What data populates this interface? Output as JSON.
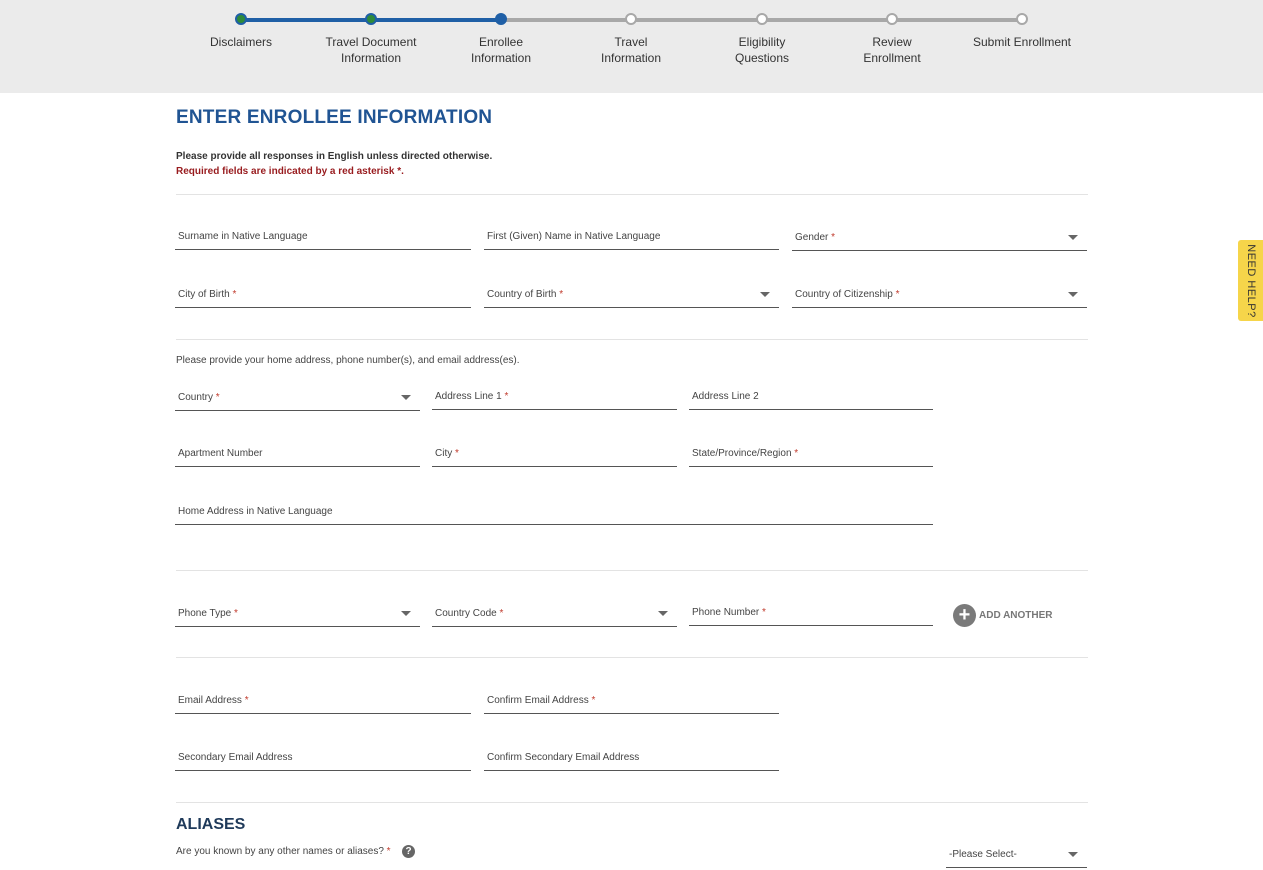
{
  "progress": {
    "steps": [
      {
        "line1": "Disclaimers",
        "line2": "",
        "state": "done"
      },
      {
        "line1": "Travel Document",
        "line2": "Information",
        "state": "done"
      },
      {
        "line1": "Enrollee",
        "line2": "Information",
        "state": "current"
      },
      {
        "line1": "Travel",
        "line2": "Information",
        "state": "pending"
      },
      {
        "line1": "Eligibility",
        "line2": "Questions",
        "state": "pending"
      },
      {
        "line1": "Review",
        "line2": "Enrollment",
        "state": "pending"
      },
      {
        "line1": "Submit Enrollment",
        "line2": "",
        "state": "pending"
      }
    ]
  },
  "page": {
    "title": "ENTER ENROLLEE INFORMATION",
    "intro": "Please provide all responses in English unless directed otherwise.",
    "required_note": "Required fields are indicated by a red asterisk *."
  },
  "personal": {
    "surname_native": {
      "label": "Surname in Native Language"
    },
    "first_name_native": {
      "label": "First (Given) Name in Native Language"
    },
    "gender": {
      "label": "Gender",
      "star": "*"
    },
    "city_of_birth": {
      "label": "City of Birth",
      "star": "*"
    },
    "country_of_birth": {
      "label": "Country of Birth",
      "star": "*"
    },
    "country_of_citizenship": {
      "label": "Country of Citizenship",
      "star": "*"
    }
  },
  "address": {
    "note": "Please provide your home address, phone number(s), and email address(es).",
    "country": {
      "label": "Country",
      "star": "*"
    },
    "line1": {
      "label": "Address Line 1",
      "star": "*"
    },
    "line2": {
      "label": "Address Line 2"
    },
    "apartment": {
      "label": "Apartment Number"
    },
    "city": {
      "label": "City",
      "star": "*"
    },
    "state": {
      "label": "State/Province/Region",
      "star": "*"
    },
    "native": {
      "label": "Home Address in Native Language"
    }
  },
  "phone": {
    "type": {
      "label": "Phone Type",
      "star": "*"
    },
    "country_code": {
      "label": "Country Code",
      "star": "*"
    },
    "number": {
      "label": "Phone Number",
      "star": "*"
    },
    "add_another": "ADD ANOTHER"
  },
  "email": {
    "primary": {
      "label": "Email Address",
      "star": "*"
    },
    "confirm_primary": {
      "label": "Confirm Email Address",
      "star": "*"
    },
    "secondary": {
      "label": "Secondary Email Address"
    },
    "confirm_secondary": {
      "label": "Confirm Secondary Email Address"
    }
  },
  "aliases": {
    "title": "ALIASES",
    "question": "Are you known by any other names or aliases?",
    "star": "*",
    "select_value": "-Please Select-"
  },
  "need_help": "NEED HELP?"
}
